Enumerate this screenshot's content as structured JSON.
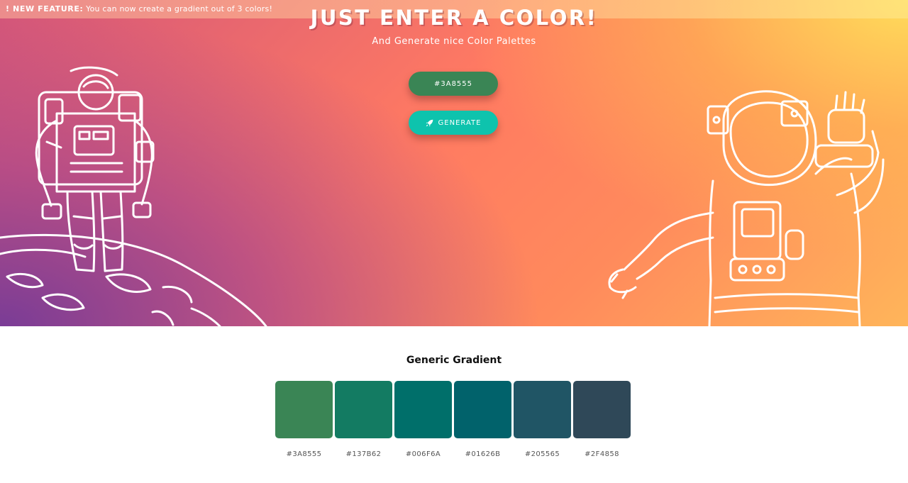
{
  "banner": {
    "tag": "! NEW FEATURE:",
    "text": "You can now create a gradient out of 3 colors!"
  },
  "hero": {
    "title": "JUST ENTER A COLOR!",
    "subtitle": "And Generate nice Color Palettes",
    "color_input_value": "#3A8555",
    "generate_label": "GENERATE",
    "generate_icon": "rocket-icon"
  },
  "palette": {
    "title": "Generic Gradient",
    "colors": [
      "#3A8555",
      "#137B62",
      "#006F6A",
      "#01626B",
      "#205565",
      "#2F4858"
    ]
  },
  "colors": {
    "input_bg": "#3A8555",
    "button_bg": "#0ec3ad",
    "hero_orange": "#ff7a62",
    "hero_purple": "#7a3c96",
    "hero_yellow": "#ffe05a"
  }
}
